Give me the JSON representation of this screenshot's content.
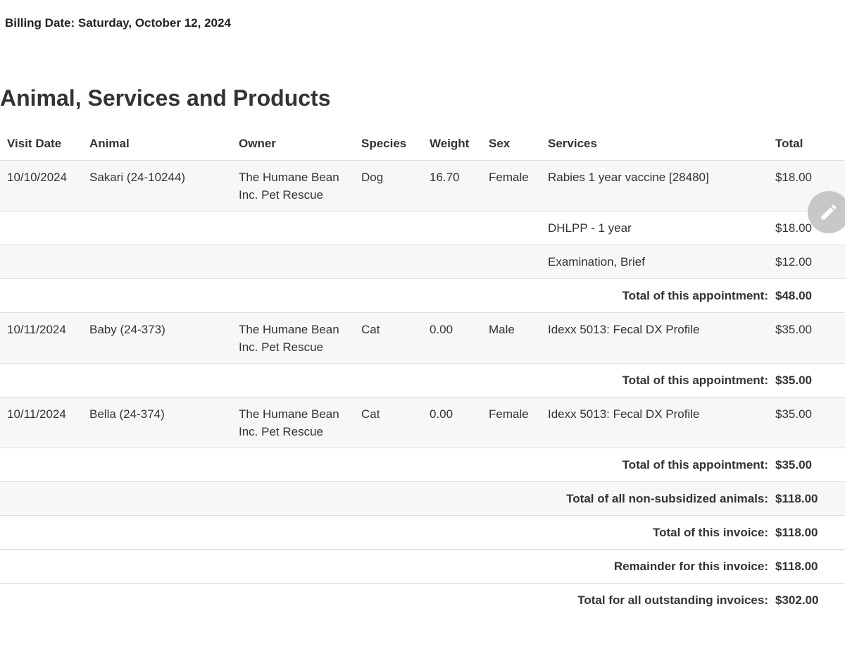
{
  "billing": {
    "date_label": "Billing Date: Saturday, October 12, 2024"
  },
  "section": {
    "title": "Animal, Services and Products"
  },
  "table": {
    "headers": [
      "Visit Date",
      "Animal",
      "Owner",
      "Species",
      "Weight",
      "Sex",
      "Services",
      "Total"
    ],
    "appointments": [
      {
        "visit_date": "10/10/2024",
        "animal": "Sakari (24-10244)",
        "owner": "The Humane Bean Inc. Pet Rescue",
        "species": "Dog",
        "weight": "16.70",
        "sex": "Female",
        "services": [
          {
            "name": "Rabies 1 year vaccine [28480]",
            "price": "$18.00"
          },
          {
            "name": "DHLPP - 1 year",
            "price": "$18.00"
          },
          {
            "name": "Examination, Brief",
            "price": "$12.00"
          }
        ],
        "total_label": "Total of this appointment:",
        "total": "$48.00"
      },
      {
        "visit_date": "10/11/2024",
        "animal": "Baby (24-373)",
        "owner": "The Humane Bean Inc. Pet Rescue",
        "species": "Cat",
        "weight": "0.00",
        "sex": "Male",
        "services": [
          {
            "name": "Idexx 5013: Fecal DX Profile",
            "price": "$35.00"
          }
        ],
        "total_label": "Total of this appointment:",
        "total": "$35.00"
      },
      {
        "visit_date": "10/11/2024",
        "animal": "Bella (24-374)",
        "owner": "The Humane Bean Inc. Pet Rescue",
        "species": "Cat",
        "weight": "0.00",
        "sex": "Female",
        "services": [
          {
            "name": "Idexx 5013: Fecal DX Profile",
            "price": "$35.00"
          }
        ],
        "total_label": "Total of this appointment:",
        "total": "$35.00"
      }
    ],
    "summary": [
      {
        "label": "Total of all non-subsidized animals:",
        "value": "$118.00"
      },
      {
        "label": "Total of this invoice:",
        "value": "$118.00"
      },
      {
        "label": "Remainder for this invoice:",
        "value": "$118.00"
      },
      {
        "label": "Total for all outstanding invoices:",
        "value": "$302.00"
      }
    ]
  },
  "fab": {
    "icon": "pencil-icon",
    "color": "#bebebe"
  }
}
